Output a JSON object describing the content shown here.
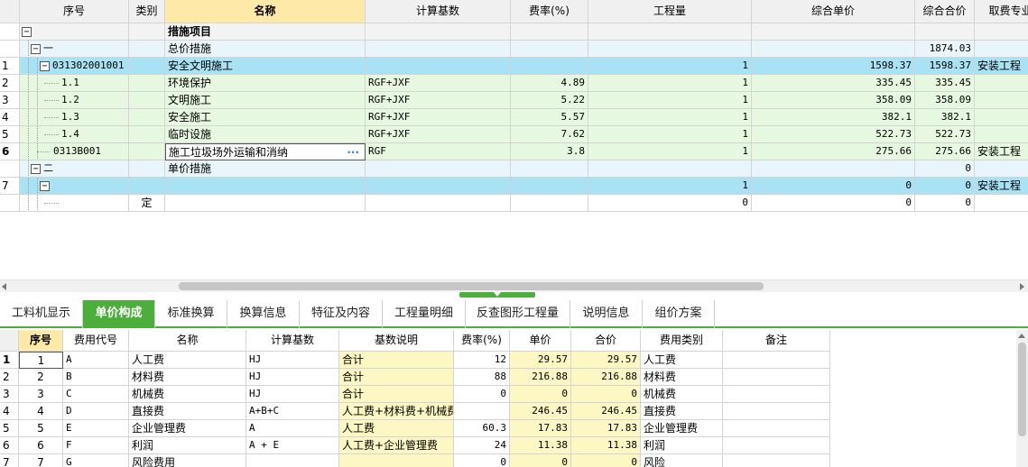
{
  "top": {
    "headers": [
      "序号",
      "类别",
      "名称",
      "计算基数",
      "费率(%)",
      "工程量",
      "综合单价",
      "综合合价",
      "取费专业"
    ],
    "rows": [
      {
        "no": "",
        "code": "",
        "cat": "",
        "name": "措施项目",
        "base": "",
        "rate": "",
        "qty": "",
        "price": "",
        "total": "",
        "spec": "",
        "bg": "#f3f3f3",
        "nameBold": true,
        "toggle": "−",
        "indent": 0
      },
      {
        "no": "",
        "code": "一",
        "cat": "",
        "name": "总价措施",
        "base": "",
        "rate": "",
        "qty": "",
        "price": "",
        "total": "1874.03",
        "spec": "",
        "bg": "#e8f6fb",
        "toggle": "−",
        "indent": 1
      },
      {
        "no": "1",
        "code": "031302001001",
        "cat": "",
        "name": "安全文明施工",
        "base": "",
        "rate": "",
        "qty": "1",
        "price": "1598.37",
        "total": "1598.37",
        "spec": "安装工程",
        "bg": "#a9e1f5",
        "toggle": "−",
        "indent": 2
      },
      {
        "no": "2",
        "code": "1.1",
        "cat": "",
        "name": "环境保护",
        "base": "RGF+JXF",
        "rate": "4.89",
        "qty": "1",
        "price": "335.45",
        "total": "335.45",
        "spec": "",
        "bg": "#e6f8df",
        "indent": 3
      },
      {
        "no": "3",
        "code": "1.2",
        "cat": "",
        "name": "文明施工",
        "base": "RGF+JXF",
        "rate": "5.22",
        "qty": "1",
        "price": "358.09",
        "total": "358.09",
        "spec": "",
        "bg": "#e6f8df",
        "indent": 3
      },
      {
        "no": "4",
        "code": "1.3",
        "cat": "",
        "name": "安全施工",
        "base": "RGF+JXF",
        "rate": "5.57",
        "qty": "1",
        "price": "382.1",
        "total": "382.1",
        "spec": "",
        "bg": "#e6f8df",
        "indent": 3
      },
      {
        "no": "5",
        "code": "1.4",
        "cat": "",
        "name": "临时设施",
        "base": "RGF+JXF",
        "rate": "7.62",
        "qty": "1",
        "price": "522.73",
        "total": "522.73",
        "spec": "",
        "bg": "#e6f8df",
        "indent": 3
      },
      {
        "no": "6",
        "code": "0313B001",
        "cat": "",
        "name": "施工垃圾场外运输和消纳",
        "base": "RGF",
        "rate": "3.8",
        "qty": "1",
        "price": "275.66",
        "total": "275.66",
        "spec": "安装工程",
        "bg": "#e6f8df",
        "indent": 2,
        "selected": true
      },
      {
        "no": "",
        "code": "二",
        "cat": "",
        "name": "单价措施",
        "base": "",
        "rate": "",
        "qty": "",
        "price": "",
        "total": "0",
        "spec": "",
        "bg": "#e8f6fb",
        "toggle": "−",
        "indent": 1
      },
      {
        "no": "7",
        "code": "",
        "cat": "",
        "name": "",
        "base": "",
        "rate": "",
        "qty": "1",
        "price": "0",
        "total": "0",
        "spec": "安装工程",
        "bg": "#a9e1f5",
        "toggle": "−",
        "indent": 2
      },
      {
        "no": "",
        "code": "",
        "cat": "定",
        "name": "",
        "base": "",
        "rate": "",
        "qty": "0",
        "price": "0",
        "total": "0",
        "spec": "",
        "bg": "#ffffff",
        "indent": 3
      }
    ],
    "ellipsis": "···"
  },
  "tabs": [
    "工料机显示",
    "单价构成",
    "标准换算",
    "换算信息",
    "特征及内容",
    "工程量明细",
    "反查图形工程量",
    "说明信息",
    "组价方案"
  ],
  "active_tab": 1,
  "bottom": {
    "headers": [
      "序号",
      "费用代号",
      "名称",
      "计算基数",
      "基数说明",
      "费率(%)",
      "单价",
      "合价",
      "费用类别",
      "备注"
    ],
    "rows": [
      {
        "idx": "1",
        "no": "1",
        "code": "A",
        "name": "人工费",
        "base": "HJ",
        "desc": "合计",
        "rate": "12",
        "price": "29.57",
        "total": "29.57",
        "type": "人工费"
      },
      {
        "idx": "2",
        "no": "2",
        "code": "B",
        "name": "材料费",
        "base": "HJ",
        "desc": "合计",
        "rate": "88",
        "price": "216.88",
        "total": "216.88",
        "type": "材料费"
      },
      {
        "idx": "3",
        "no": "3",
        "code": "C",
        "name": "机械费",
        "base": "HJ",
        "desc": "合计",
        "rate": "0",
        "price": "0",
        "total": "0",
        "type": "机械费"
      },
      {
        "idx": "4",
        "no": "4",
        "code": "D",
        "name": "直接费",
        "base": "A+B+C",
        "desc": "人工费+材料费+机械费",
        "rate": "",
        "price": "246.45",
        "total": "246.45",
        "type": "直接费"
      },
      {
        "idx": "5",
        "no": "5",
        "code": "E",
        "name": "企业管理费",
        "base": "A",
        "desc": "人工费",
        "rate": "60.3",
        "price": "17.83",
        "total": "17.83",
        "type": "企业管理费"
      },
      {
        "idx": "6",
        "no": "6",
        "code": "F",
        "name": "利润",
        "base": "A + E",
        "desc": "人工费+企业管理费",
        "rate": "24",
        "price": "11.38",
        "total": "11.38",
        "type": "利润"
      },
      {
        "idx": "7",
        "no": "7",
        "code": "G",
        "name": "风险费用",
        "base": "",
        "desc": "",
        "rate": "0",
        "price": "0",
        "total": "0",
        "type": "风险"
      }
    ]
  },
  "colors": {
    "selected_header": "#ffe9a8",
    "active_tab": "#4caf3c",
    "yellow_cell": "#fdf7c3"
  }
}
